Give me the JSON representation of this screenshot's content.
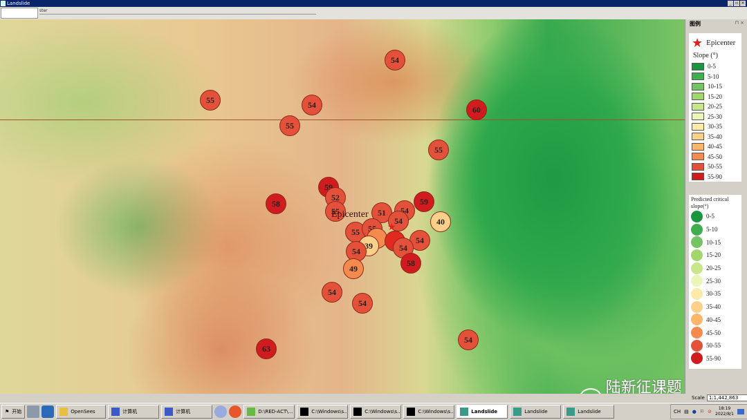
{
  "window": {
    "title": "Landslide",
    "toolbar_label": "ster",
    "buttons": [
      "_",
      "▫",
      "×"
    ]
  },
  "map": {
    "epicenter_label": "Epicenter",
    "sites": [
      54,
      55,
      54,
      55,
      60,
      55,
      59,
      52,
      58,
      55,
      51,
      54,
      59,
      54,
      40,
      55,
      55,
      null,
      39,
      null,
      54,
      54,
      54,
      58,
      49,
      54,
      54,
      63,
      54
    ]
  },
  "watermark": "陆新征课题组",
  "legend_panel": {
    "title": "图例",
    "buttons": "⊓ ×",
    "epicenter": "Epicenter",
    "slope_title": "Slope (°)",
    "slope_classes": [
      {
        "label": "0-5",
        "color": "#1a9641"
      },
      {
        "label": "5-10",
        "color": "#3fae4f"
      },
      {
        "label": "10-15",
        "color": "#74c364"
      },
      {
        "label": "15-20",
        "color": "#a3d76e"
      },
      {
        "label": "20-25",
        "color": "#c8e68a"
      },
      {
        "label": "25-30",
        "color": "#ecf6b8"
      },
      {
        "label": "30-35",
        "color": "#fde9a8"
      },
      {
        "label": "35-40",
        "color": "#fdd08a"
      },
      {
        "label": "40-45",
        "color": "#fdb56a"
      },
      {
        "label": "45-50",
        "color": "#f58a4e"
      },
      {
        "label": "50-55",
        "color": "#e4513a"
      },
      {
        "label": "55-90",
        "color": "#d01c1f"
      }
    ],
    "critical_title": "Predicted critical slope(°)",
    "critical_classes": [
      {
        "label": "0-5",
        "color": "#1a9641"
      },
      {
        "label": "5-10",
        "color": "#3fae4f"
      },
      {
        "label": "10-15",
        "color": "#74c364"
      },
      {
        "label": "15-20",
        "color": "#a3d76e"
      },
      {
        "label": "20-25",
        "color": "#c8e68a"
      },
      {
        "label": "25-30",
        "color": "#ecf6b8"
      },
      {
        "label": "30-35",
        "color": "#fde9a8"
      },
      {
        "label": "35-40",
        "color": "#fdd08a"
      },
      {
        "label": "40-45",
        "color": "#fdb56a"
      },
      {
        "label": "45-50",
        "color": "#f58a4e"
      },
      {
        "label": "50-55",
        "color": "#e4513a"
      },
      {
        "label": "55-90",
        "color": "#d01c1f"
      }
    ]
  },
  "scale": {
    "label": "Scale",
    "value": "1:1,442,863"
  },
  "taskbar": {
    "start": "开始",
    "items": [
      {
        "label": "OpenSees",
        "active": false
      },
      {
        "label": "计算机",
        "active": false
      },
      {
        "label": "计算机",
        "active": false
      },
      {
        "label": "D:\\RED-ACT\\...",
        "active": false
      },
      {
        "label": "C:\\Windows\\s...",
        "active": false
      },
      {
        "label": "C:\\Windows\\s...",
        "active": false
      },
      {
        "label": "C:\\Windows\\s...",
        "active": false
      },
      {
        "label": "Landslide",
        "active": true
      },
      {
        "label": "Landslide",
        "active": false
      },
      {
        "label": "Landslide",
        "active": false
      }
    ],
    "lang": "CH",
    "time": "18:19",
    "date": "2022/8/1"
  }
}
